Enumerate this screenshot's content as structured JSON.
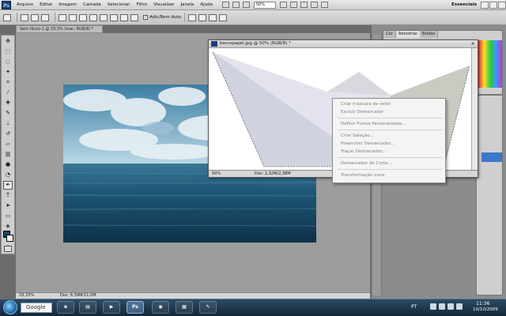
{
  "app": {
    "logo": "Ps",
    "menu": [
      "Arquivo",
      "Editar",
      "Imagem",
      "Camada",
      "Selecionar",
      "Filtro",
      "Visualizar",
      "Janela",
      "Ajuda"
    ],
    "zoom_select": "50%",
    "workspace": "Essenciais"
  },
  "options_bar": {
    "auto_add_label": "Adic/Rem Auto"
  },
  "doc_main": {
    "tab_title": "Sem título-1 @ 33,3% (mar, RGB/8) *",
    "status_zoom": "33,33%",
    "status_doc": "Doc: 6,59M/11,0M"
  },
  "doc_float": {
    "title": "barcopapel.jpg @ 50% (RGB/8) *",
    "close": "×",
    "status_zoom": "50%",
    "status_doc": "Doc: 2,32M/2,38M"
  },
  "context_menu": {
    "groups": [
      [
        {
          "label": "Criar máscara de vetor",
          "enabled": false
        },
        {
          "label": "Excluir Demarcador",
          "enabled": false
        }
      ],
      [
        {
          "label": "Definir Forma Personalizada...",
          "enabled": false
        }
      ],
      [
        {
          "label": "Criar Seleção...",
          "enabled": false
        },
        {
          "label": "Preencher Demarcador...",
          "enabled": false
        },
        {
          "label": "Traçar Demarcador...",
          "enabled": false
        }
      ],
      [
        {
          "label": "Demarcador de Corte...",
          "enabled": false
        }
      ],
      [
        {
          "label": "Transformação Livre",
          "enabled": false
        }
      ]
    ]
  },
  "panels": {
    "tabs": [
      "Cor",
      "Amostras",
      "Estilos"
    ]
  },
  "taskbar": {
    "search_text": "Google",
    "apps": [
      "ie-icon",
      "explorer-icon",
      "media-icon",
      "photoshop-icon",
      "firefox-icon",
      "app-icon",
      "tool-icon"
    ],
    "ps_label": "Ps",
    "language": "PT",
    "time": "11:36",
    "date": "10/10/2009"
  },
  "colors": {
    "foreground": "#134b6b",
    "background": "#ffffff"
  }
}
